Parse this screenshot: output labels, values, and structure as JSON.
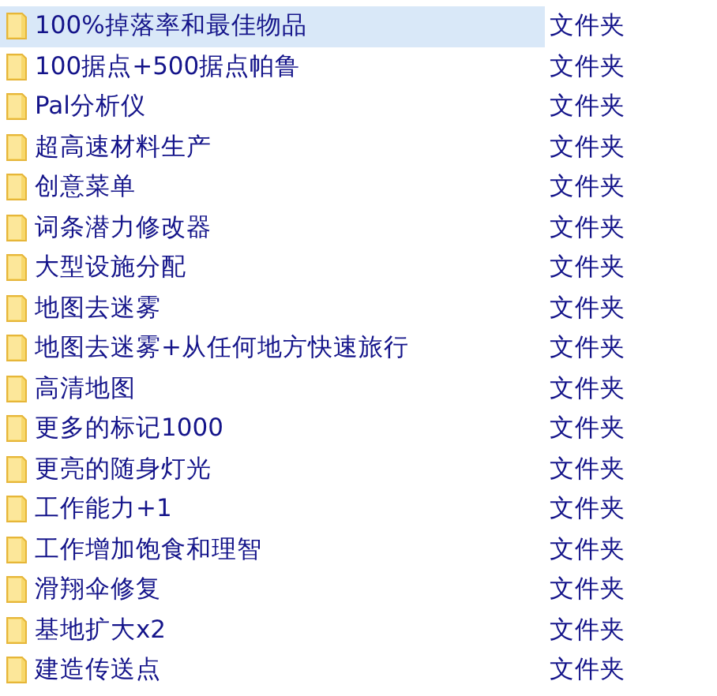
{
  "files": [
    {
      "name": "100%掉落率和最佳物品",
      "type": "文件夹",
      "selected": true
    },
    {
      "name": "100据点+500据点帕鲁",
      "type": "文件夹",
      "selected": false
    },
    {
      "name": "Pal分析仪",
      "type": "文件夹",
      "selected": false
    },
    {
      "name": "超高速材料生产",
      "type": "文件夹",
      "selected": false
    },
    {
      "name": "创意菜单",
      "type": "文件夹",
      "selected": false
    },
    {
      "name": "词条潜力修改器",
      "type": "文件夹",
      "selected": false
    },
    {
      "name": "大型设施分配",
      "type": "文件夹",
      "selected": false
    },
    {
      "name": "地图去迷雾",
      "type": "文件夹",
      "selected": false
    },
    {
      "name": "地图去迷雾+从任何地方快速旅行",
      "type": "文件夹",
      "selected": false
    },
    {
      "name": "高清地图",
      "type": "文件夹",
      "selected": false
    },
    {
      "name": "更多的标记1000",
      "type": "文件夹",
      "selected": false
    },
    {
      "name": "更亮的随身灯光",
      "type": "文件夹",
      "selected": false
    },
    {
      "name": "工作能力+1",
      "type": "文件夹",
      "selected": false
    },
    {
      "name": "工作增加饱食和理智",
      "type": "文件夹",
      "selected": false
    },
    {
      "name": "滑翔伞修复",
      "type": "文件夹",
      "selected": false
    },
    {
      "name": "基地扩大x2",
      "type": "文件夹",
      "selected": false
    },
    {
      "name": "建造传送点",
      "type": "文件夹",
      "selected": false
    }
  ]
}
